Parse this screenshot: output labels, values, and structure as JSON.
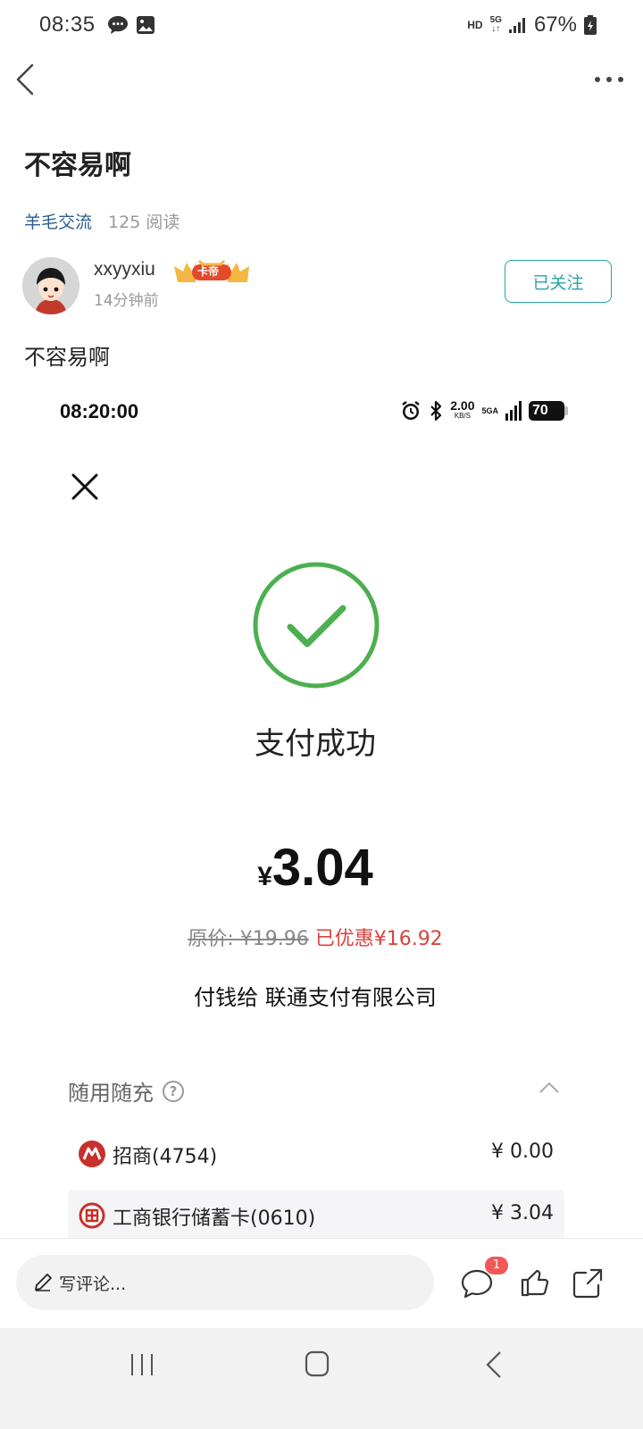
{
  "status_bar": {
    "time": "08:35",
    "network_hd": "HD",
    "network_5g": "5G",
    "battery": "67%"
  },
  "post": {
    "title": "不容易啊",
    "forum": "羊毛交流",
    "read_count": "125 阅读",
    "author": {
      "name": "xxyyxiu",
      "badge": "卡帝",
      "time": "14分钟前"
    },
    "follow_label": "已关注",
    "body": "不容易啊"
  },
  "embedded": {
    "status_time": "08:20:00",
    "speed": "2.00",
    "speed_unit": "KB/S",
    "network": "5GA",
    "battery": "70",
    "success_text": "支付成功",
    "amount_symbol": "¥",
    "amount": "3.04",
    "original_price": "原价: ¥19.96",
    "saved": "已优惠¥16.92",
    "payee": "付钱给 联通支付有限公司",
    "method_header": "随用随充",
    "methods": [
      {
        "name": "招商(4754)",
        "amount": "¥ 0.00"
      },
      {
        "name": "工商银行储蓄卡(0610)",
        "amount": "¥ 3.04"
      }
    ]
  },
  "comment_bar": {
    "placeholder": "写评论...",
    "comment_count": "1"
  },
  "colors": {
    "accent_teal": "#29a3a3",
    "link_blue": "#2a5d8f",
    "success_green": "#4caf50",
    "discount_red": "#d9433d",
    "badge_red": "#f25858"
  }
}
